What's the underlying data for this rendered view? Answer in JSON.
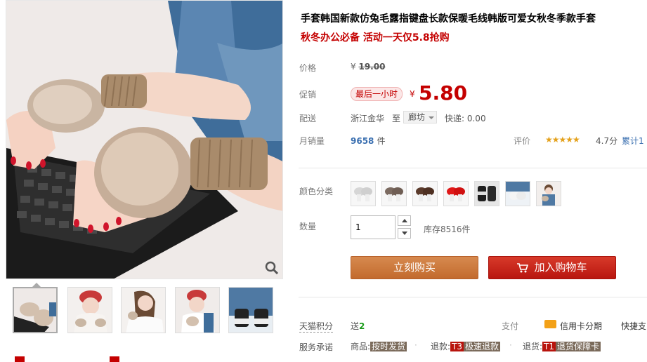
{
  "product": {
    "title": "手套韩国新款仿兔毛露指键盘长款保暖毛线韩版可爱女秋冬季款手套",
    "subtitle": "秋冬办公必备 活动一天仅5.8抢购"
  },
  "pricing": {
    "price_label": "价格",
    "original_currency": "¥",
    "original_price": "19.00",
    "promo_label": "促销",
    "promo_badge": "最后一小时",
    "promo_currency": "¥",
    "promo_price": "5.80"
  },
  "shipping": {
    "label": "配送",
    "from": "浙江金华",
    "to_label": "至",
    "destination": "廊坊",
    "express": "快递: 0.00"
  },
  "sales": {
    "label": "月销量",
    "count": "9658",
    "unit": "件",
    "rating_label": "评价",
    "stars": "★★★★★",
    "rating_value": 4.7,
    "rating_text": "4.7分",
    "cumulative": "累计1"
  },
  "colors": {
    "label": "颜色分类",
    "options": [
      "white-gloves",
      "gray-brown-gloves",
      "brown-gloves",
      "red-gloves",
      "black-gloves",
      "photo-variant-1",
      "photo-variant-2"
    ]
  },
  "quantity": {
    "label": "数量",
    "value": "1",
    "stock": "库存8516件"
  },
  "actions": {
    "buy_now": "立刻购买",
    "add_to_cart": "加入购物车"
  },
  "points": {
    "label": "天猫积分",
    "prefix": "送",
    "value": "2",
    "pay_label": "支付",
    "credit_card": "信用卡分期",
    "quick_pay": "快捷支"
  },
  "promise": {
    "label": "服务承诺",
    "item1_label": "商品:",
    "item1_tag": "按时发货",
    "item2_label": "退款:",
    "item2_code": "T3",
    "item2_tag": "极速退款",
    "item3_label": "退货:",
    "item3_code": "T1",
    "item3_tag": "退货保障卡",
    "dot": "·"
  },
  "colors_theme": {
    "price_red": "#c40000",
    "buy_orange": "#c97a3b",
    "cart_red": "#c41d12",
    "link_blue": "#3a6fb0"
  }
}
